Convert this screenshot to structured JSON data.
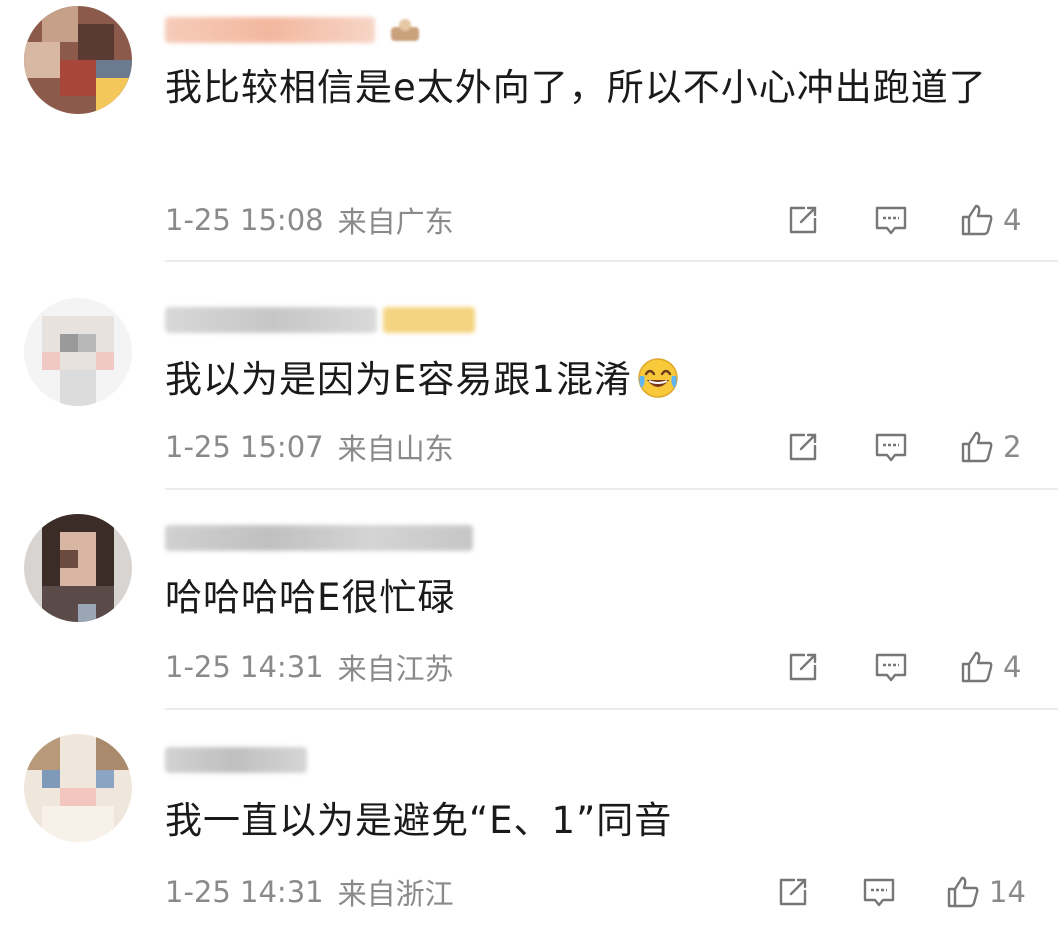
{
  "comments": [
    {
      "text": "我比较相信是e太外向了，所以不小心冲出跑道了",
      "time": "1-25 15:08",
      "location": "来自广东",
      "likes": "4"
    },
    {
      "text": "我以为是因为E容易跟1混淆",
      "emoji": "crying-laughing-emoji",
      "time": "1-25 15:07",
      "location": "来自山东",
      "likes": "2"
    },
    {
      "text": "哈哈哈哈E很忙碌",
      "time": "1-25 14:31",
      "location": "来自江苏",
      "likes": "4"
    },
    {
      "text": "我一直以为是避免“E、1”同音",
      "time": "1-25 14:31",
      "location": "来自浙江",
      "likes": "14"
    }
  ],
  "icons": {
    "share": "share-icon",
    "comment": "comment-icon",
    "like": "thumbs-up-icon"
  },
  "colors": {
    "meta_gray": "#8a8a8a",
    "divider": "#ececec"
  }
}
